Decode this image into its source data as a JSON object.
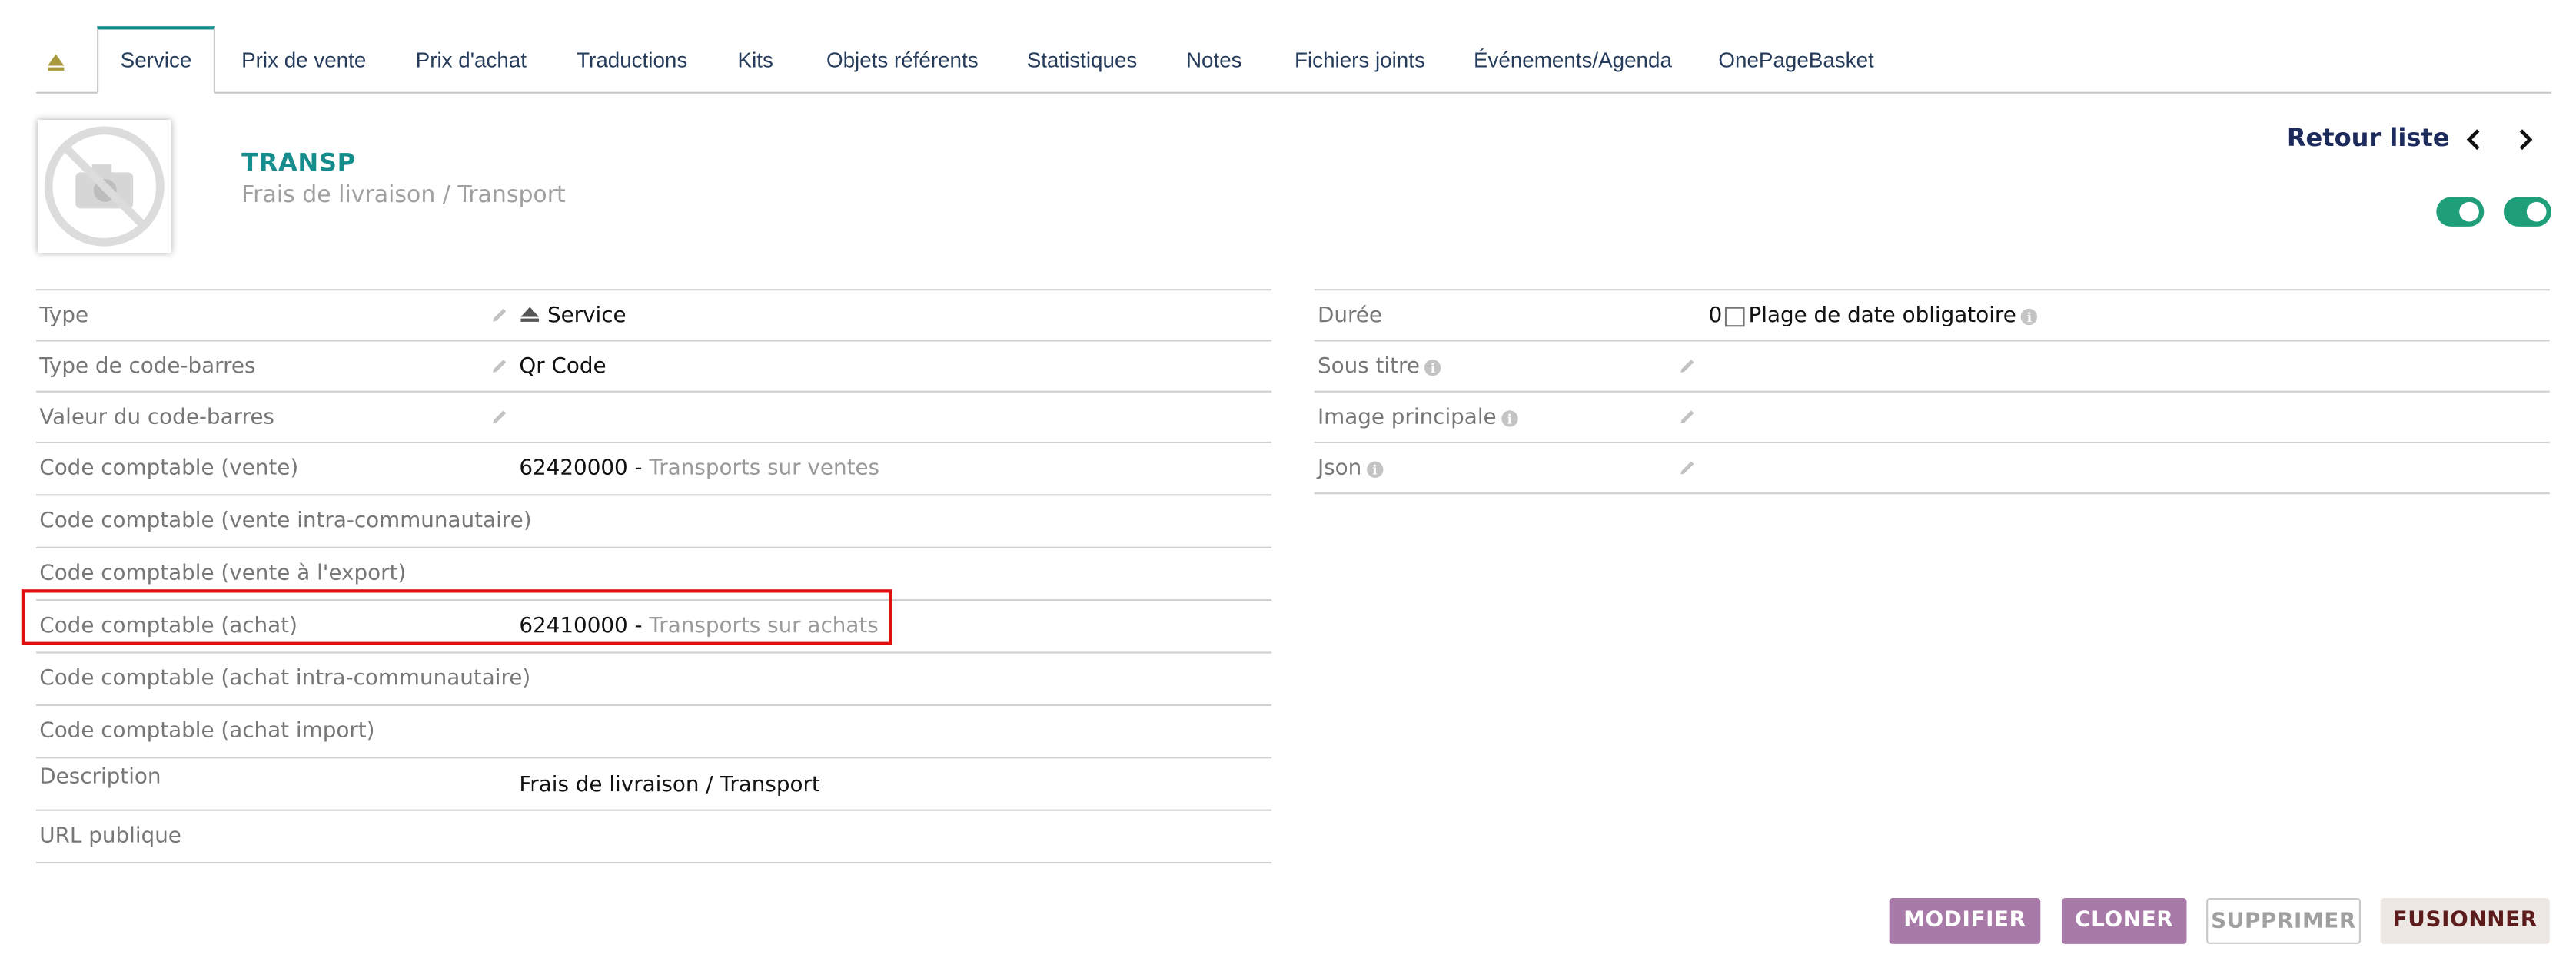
{
  "tabs": {
    "items": [
      "Service",
      "Prix de vente",
      "Prix d'achat",
      "Traductions",
      "Kits",
      "Objets référents",
      "Statistiques",
      "Notes",
      "Fichiers joints",
      "Événements/Agenda",
      "OnePageBasket"
    ]
  },
  "header": {
    "ref": "TRANSP",
    "label": "Frais de livraison / Transport",
    "back_link": "Retour liste"
  },
  "left_fields": {
    "rows": [
      {
        "label": "Type",
        "value": "Service",
        "value_muted": ""
      },
      {
        "label": "Type de code-barres",
        "value": "Qr Code",
        "value_muted": ""
      },
      {
        "label": "Valeur du code-barres",
        "value": "",
        "value_muted": ""
      },
      {
        "label": "Code comptable (vente)",
        "value": "62420000 - ",
        "value_muted": "Transports sur ventes"
      },
      {
        "label": "Code comptable (vente intra-communautaire)",
        "value": "",
        "value_muted": ""
      },
      {
        "label": "Code comptable (vente à l'export)",
        "value": "",
        "value_muted": ""
      },
      {
        "label": "Code comptable (achat)",
        "value": "62410000 - ",
        "value_muted": "Transports sur achats"
      },
      {
        "label": "Code comptable (achat intra-communautaire)",
        "value": "",
        "value_muted": ""
      },
      {
        "label": "Code comptable (achat import)",
        "value": "",
        "value_muted": ""
      },
      {
        "label": "Description",
        "value": "Frais de livraison / Transport",
        "value_muted": ""
      },
      {
        "label": "URL publique",
        "value": "",
        "value_muted": ""
      }
    ]
  },
  "right_fields": {
    "rows": [
      {
        "label": "Durée",
        "value": "0",
        "extra": "Plage de date obligatoire"
      },
      {
        "label": "Sous titre",
        "value": "",
        "extra": ""
      },
      {
        "label": "Image principale",
        "value": "",
        "extra": ""
      },
      {
        "label": "Json",
        "value": "",
        "extra": ""
      }
    ]
  },
  "actions": {
    "modify": "MODIFIER",
    "clone": "CLONER",
    "delete": "SUPPRIMER",
    "merge": "FUSIONNER"
  },
  "colors": {
    "accent": "#178c8c",
    "toggle_on": "#1f9e7a",
    "button_purple": "#a77aa8",
    "highlight": "#e01010"
  }
}
